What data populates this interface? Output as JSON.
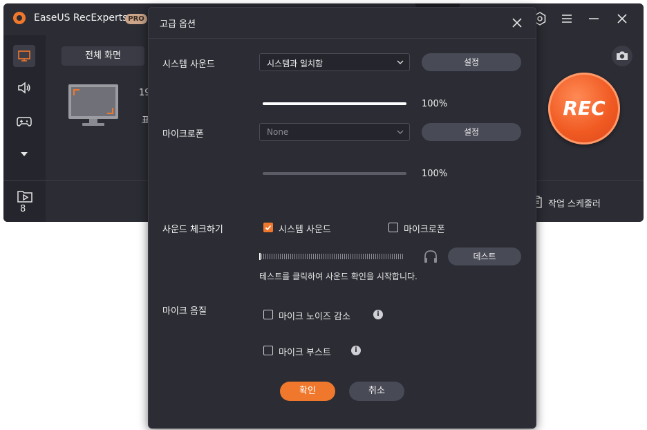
{
  "app": {
    "title": "EaseUS RecExperts",
    "badge": "PRO",
    "fullscreen_tab": "전체 화면",
    "partial_resolution": "19",
    "partial_text": "표",
    "files_count": "8",
    "rec_label": "REC",
    "scheduler_label": "작업 스케줄러",
    "icons": {
      "logo": "app-logo-icon",
      "settings": "gear-icon",
      "menu": "menu-icon",
      "minimize": "minimize-icon",
      "close": "close-icon",
      "screen": "monitor-icon",
      "audio": "speaker-icon",
      "game": "gamepad-icon",
      "more": "chevron-down-icon",
      "files": "folder-video-icon",
      "camera": "camera-icon",
      "scheduler": "clipboard-icon"
    },
    "colors": {
      "accent": "#f0782d",
      "background": "#2b2c34",
      "rec": "#f05a22"
    }
  },
  "dialog": {
    "title": "고급 옵션",
    "system_sound": {
      "label": "시스템 사운드",
      "select_value": "시스템과 일치함",
      "settings_label": "설정",
      "volume_percent": 100,
      "volume_text": "100%"
    },
    "microphone": {
      "label": "마이크로폰",
      "select_value": "None",
      "settings_label": "설정",
      "volume_percent": 100,
      "volume_text": "100%"
    },
    "sound_check": {
      "label": "사운드 체크하기",
      "system_sound_checkbox": {
        "label": "시스템 사운드",
        "checked": true
      },
      "microphone_checkbox": {
        "label": "마이크로폰",
        "checked": false
      },
      "test_label": "데스트",
      "hint": "테스트를 클릭하여 사운드 확인을 시작합니다."
    },
    "mic_quality": {
      "label": "마이크 음질",
      "noise_reduction": {
        "label": "마이크 노이즈 감소",
        "checked": false
      },
      "boost": {
        "label": "마이크 부스트",
        "checked": false
      },
      "info_glyph": "i"
    },
    "confirm_label": "확인",
    "cancel_label": "취소"
  }
}
